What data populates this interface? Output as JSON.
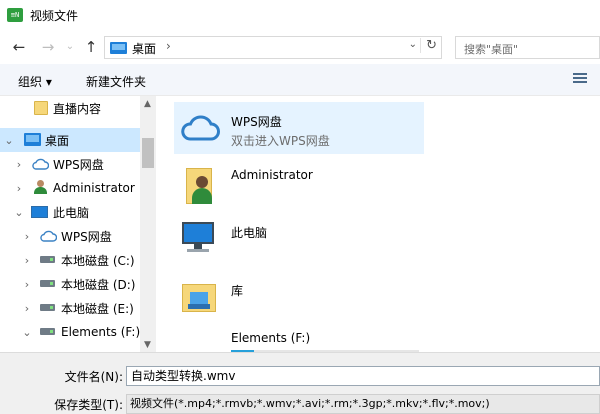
{
  "window": {
    "title": "视频文件",
    "app_icon_text": "≡N"
  },
  "nav": {
    "back": "←",
    "forward": "→",
    "dropdown": "⌄",
    "up": "↑",
    "address": {
      "label": "桌面",
      "separator": "›"
    },
    "address_dropdown": "⌄",
    "refresh": "↻",
    "search": {
      "placeholder": "搜索\"桌面\""
    }
  },
  "toolbar": {
    "organize": "组织 ▾",
    "new_folder": "新建文件夹"
  },
  "tree": {
    "items": [
      {
        "label": "直播内容",
        "icon": "folder-icon",
        "expander": ""
      },
      {
        "label": "桌面",
        "icon": "desktop-icon",
        "expander": "⌄",
        "selected": true
      },
      {
        "label": "WPS网盘",
        "icon": "cloud-icon",
        "expander": "›"
      },
      {
        "label": "Administrator",
        "icon": "user-icon",
        "expander": "›"
      },
      {
        "label": "此电脑",
        "icon": "computer-icon",
        "expander": "⌄"
      },
      {
        "label": "WPS网盘",
        "icon": "cloud-icon",
        "expander": "›"
      },
      {
        "label": "本地磁盘 (C:)",
        "icon": "disk-icon",
        "expander": "›"
      },
      {
        "label": "本地磁盘 (D:)",
        "icon": "disk-icon",
        "expander": "›"
      },
      {
        "label": "本地磁盘 (E:)",
        "icon": "disk-icon",
        "expander": "›"
      },
      {
        "label": "Elements (F:)",
        "icon": "disk-icon",
        "expander": "⌄"
      }
    ],
    "scroll_up": "▲",
    "scroll_down": "▼"
  },
  "main": {
    "items": [
      {
        "name": "WPS网盘",
        "sub": "双击进入WPS网盘",
        "icon": "cloud-icon"
      },
      {
        "name": "Administrator",
        "icon": "user-folder-icon"
      },
      {
        "name": "此电脑",
        "icon": "computer-icon"
      },
      {
        "name": "库",
        "icon": "library-icon"
      },
      {
        "name": "Elements (F:)",
        "icon": "drive-icon"
      }
    ]
  },
  "form": {
    "filename_label": "文件名(N):",
    "filename_value": "自动类型转换.wmv",
    "filetype_label": "保存类型(T):",
    "filetype_value": "视频文件(*.mp4;*.rmvb;*.wmv;*.avi;*.rm;*.3gp;*.mkv;*.flv;*.mov;)"
  }
}
